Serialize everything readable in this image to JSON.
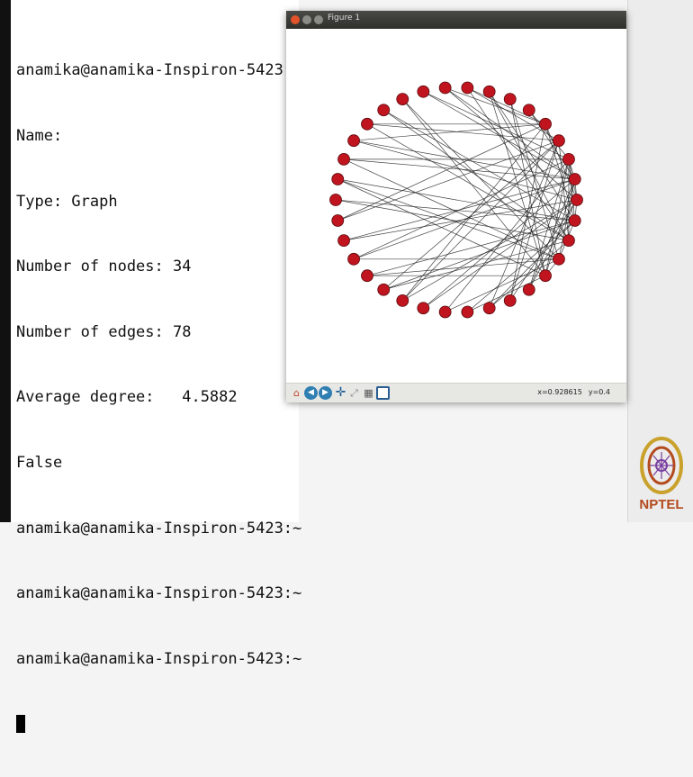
{
  "terminal": {
    "lines": [
      "anamika@anamika-Inspiron-5423:~",
      "Name:",
      "Type: Graph",
      "Number of nodes: 34",
      "Number of edges: 78",
      "Average degree:   4.5882",
      "False",
      "anamika@anamika-Inspiron-5423:~",
      "anamika@anamika-Inspiron-5423:~",
      "anamika@anamika-Inspiron-5423:~"
    ]
  },
  "figure_window": {
    "title": "Figure 1",
    "status": {
      "x": "x=0.928615",
      "y": "y=0.4"
    },
    "toolbar": [
      "home-icon",
      "back-icon",
      "forward-icon",
      "pan-icon",
      "zoom-icon",
      "configure-icon",
      "save-icon"
    ]
  },
  "graph": {
    "layout": "circular",
    "node_count": 34,
    "edge_count": 78,
    "node_color": "#c0151f",
    "edge_color": "#222222"
  },
  "logo": {
    "text": "NPTEL",
    "color": "#b34a1d"
  }
}
